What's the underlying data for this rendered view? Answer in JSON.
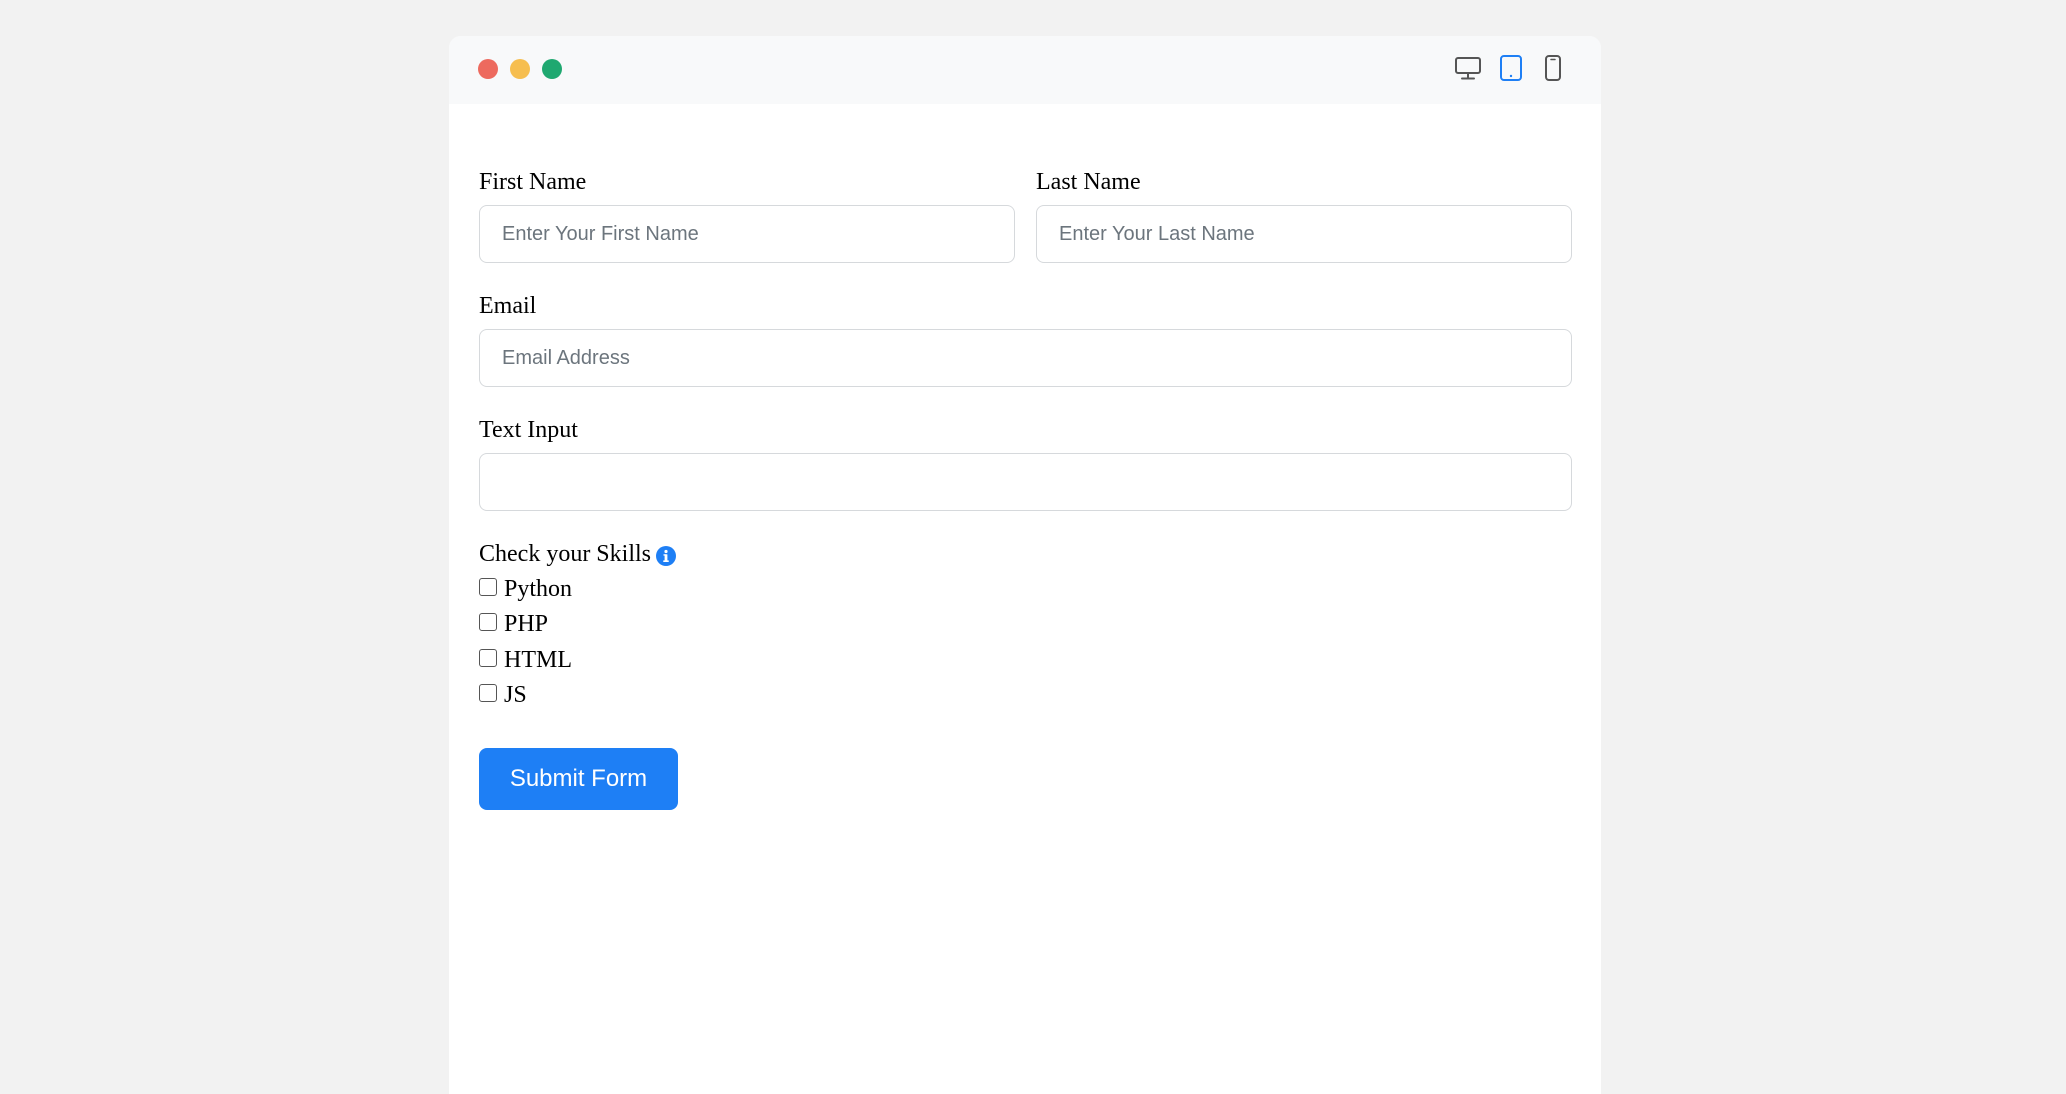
{
  "window": {
    "controls": [
      "close",
      "minimize",
      "maximize"
    ],
    "control_colors": {
      "close": "#ed6a5e",
      "minimize": "#f6be4f",
      "maximize": "#1fa870"
    },
    "device_icons": [
      "desktop-icon",
      "tablet-icon",
      "mobile-icon"
    ],
    "active_device": "tablet",
    "accent_color": "#1e7ff5"
  },
  "form": {
    "first_name": {
      "label": "First Name",
      "placeholder": "Enter Your First Name",
      "value": ""
    },
    "last_name": {
      "label": "Last Name",
      "placeholder": "Enter Your Last Name",
      "value": ""
    },
    "email": {
      "label": "Email",
      "placeholder": "Email Address",
      "value": ""
    },
    "text_input": {
      "label": "Text Input",
      "placeholder": "",
      "value": ""
    },
    "skills": {
      "label": "Check your Skills",
      "info_icon": "info-icon",
      "options": [
        {
          "label": "Python",
          "checked": false
        },
        {
          "label": "PHP",
          "checked": false
        },
        {
          "label": "HTML",
          "checked": false
        },
        {
          "label": "JS",
          "checked": false
        }
      ]
    },
    "submit_label": "Submit Form"
  }
}
